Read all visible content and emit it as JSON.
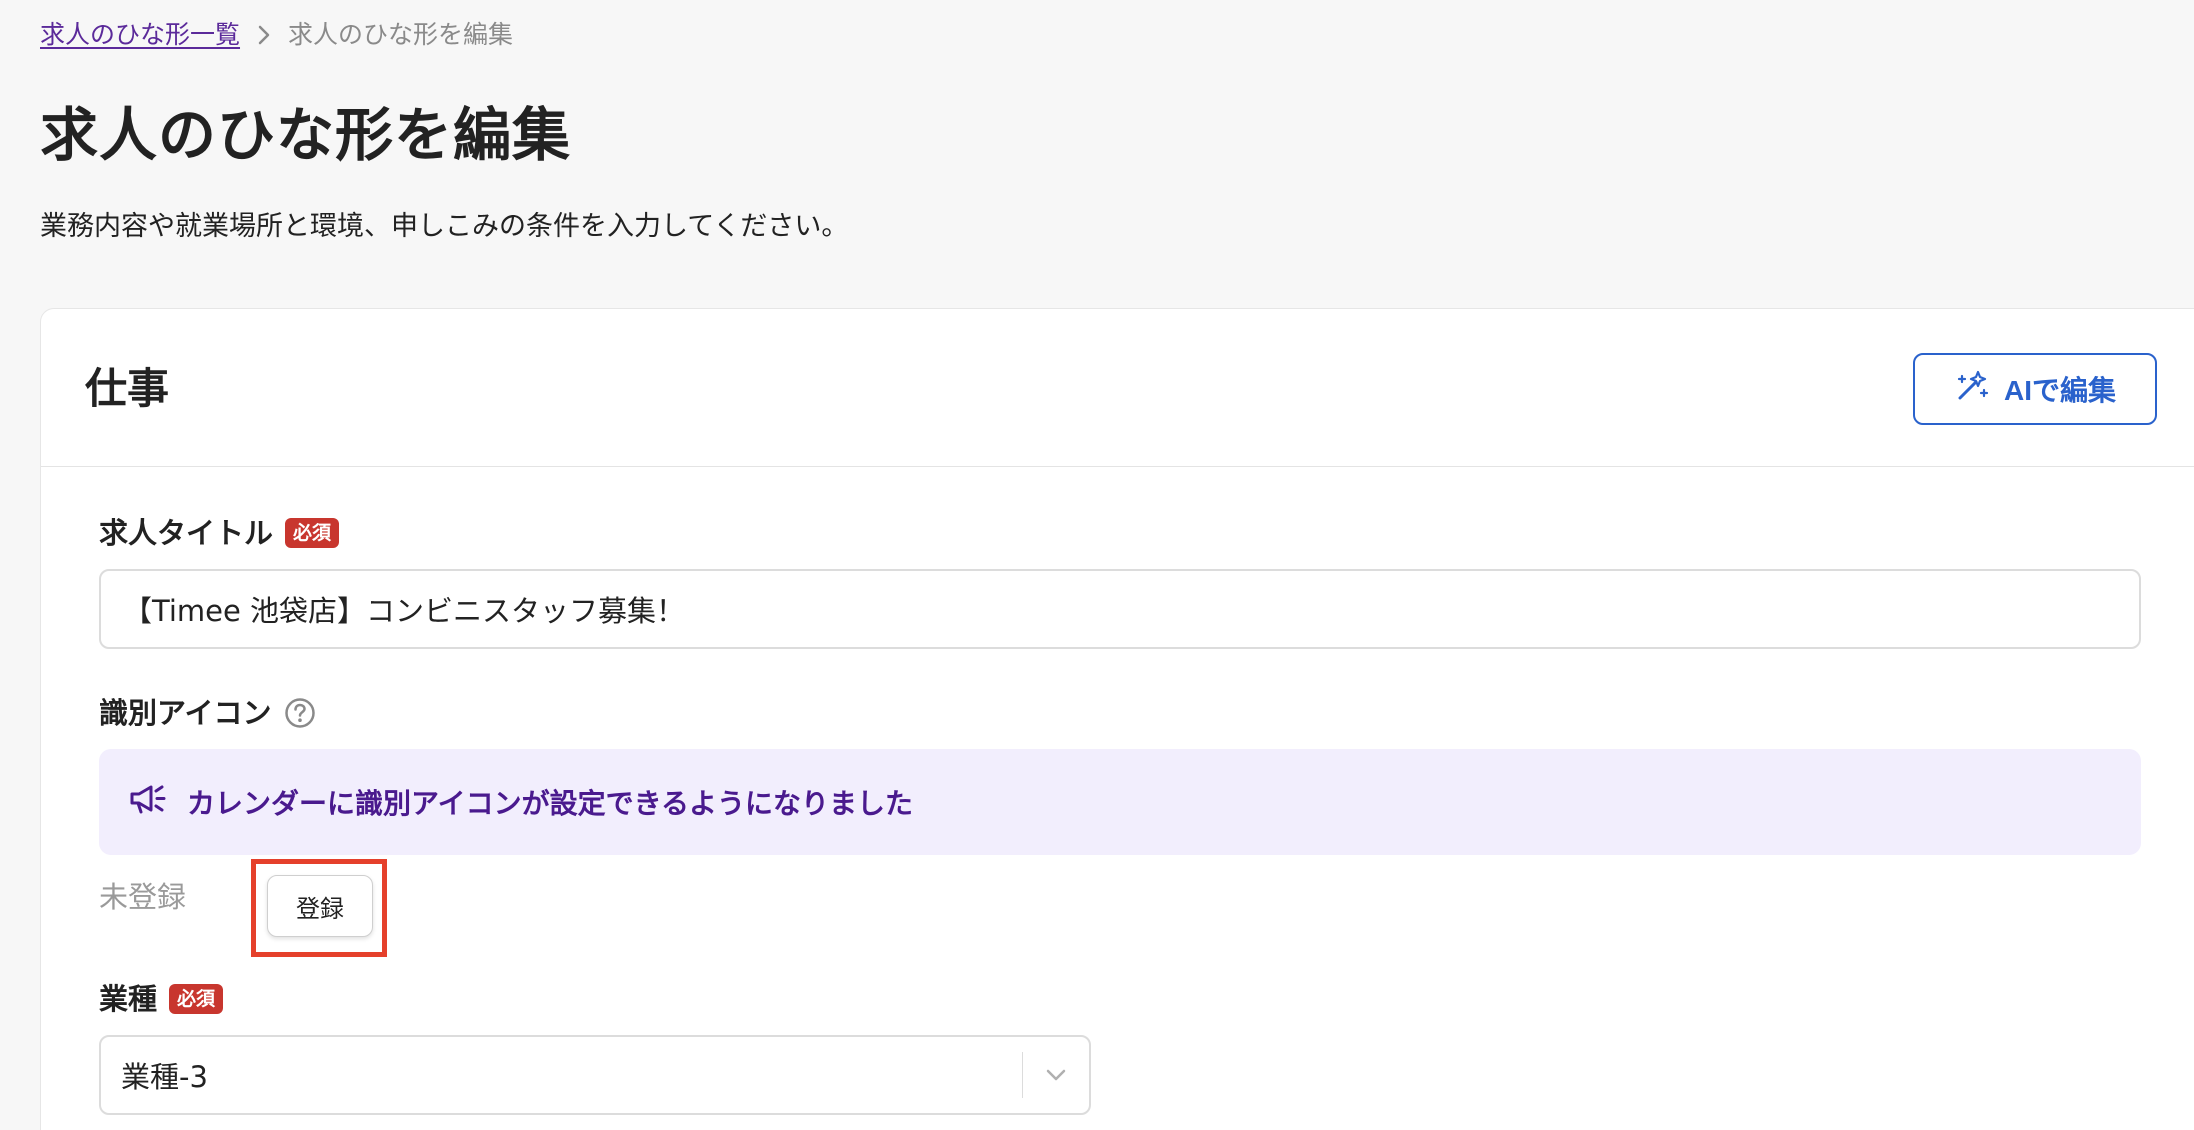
{
  "breadcrumb": {
    "parent": "求人のひな形一覧",
    "current": "求人のひな形を編集"
  },
  "page": {
    "title": "求人のひな形を編集",
    "description": "業務内容や就業場所と環境、申しこみの条件を入力してください。"
  },
  "card": {
    "title": "仕事",
    "ai_button_label": "AIで編集"
  },
  "fields": {
    "job_title": {
      "label": "求人タイトル",
      "required_badge": "必須",
      "value": "【Timee 池袋店】コンビニスタッフ募集！"
    },
    "identifier_icon": {
      "label": "識別アイコン",
      "notice": "カレンダーに識別アイコンが設定できるようになりました",
      "status": "未登録",
      "register_button": "登録"
    },
    "industry": {
      "label": "業種",
      "required_badge": "必須",
      "value": "業種-3"
    }
  },
  "colors": {
    "accent_blue": "#2a62cc",
    "notice_bg": "#f2eefd",
    "notice_text": "#4a1a8e",
    "required_red": "#c8362e",
    "highlight_red": "#e5402b",
    "breadcrumb_link": "#5b2a9a"
  },
  "icons": {
    "ai_button": "magic-wand-icon",
    "notice": "megaphone-icon",
    "help": "question-circle-icon",
    "breadcrumb_separator": "chevron-right-icon",
    "select_caret": "chevron-down-icon"
  }
}
